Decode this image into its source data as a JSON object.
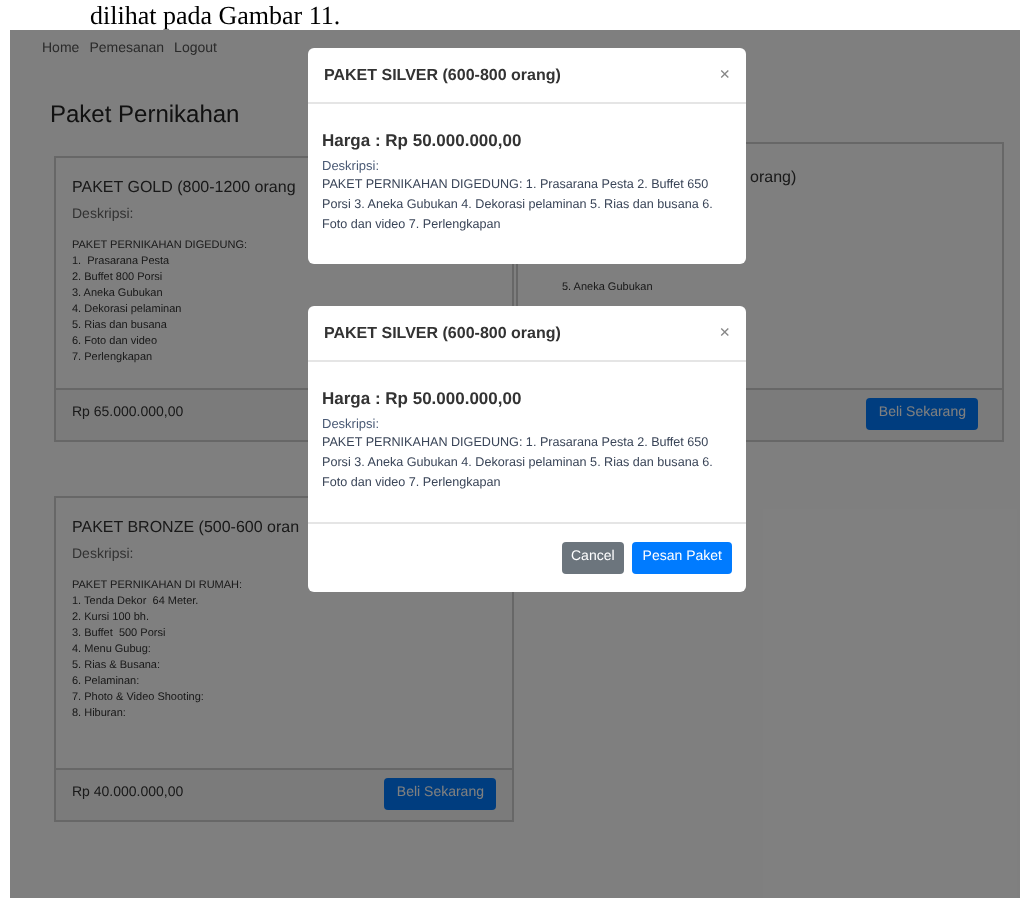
{
  "caption": "dilihat pada Gambar 11.",
  "nav": [
    {
      "label": "Home"
    },
    {
      "label": "Pemesanan"
    },
    {
      "label": "Logout"
    }
  ],
  "page_title": "Paket Pernikahan",
  "cards": [
    {
      "title": "PAKET GOLD (800-1200 orang",
      "desc_label": "Deskripsi:",
      "heading": "PAKET PERNIKAHAN DIGEDUNG:",
      "items": [
        "1.  Prasarana Pesta",
        "2. Buffet 800 Porsi",
        "3. Aneka Gubukan",
        "4. Dekorasi pelaminan",
        "5. Rias dan busana",
        "6. Foto dan video",
        "7. Perlengkapan"
      ],
      "price": "Rp 65.000.000,00"
    },
    {
      "title": "orang)",
      "items": [
        "5. Aneka Gubukan"
      ],
      "button": "Beli Sekarang"
    },
    {
      "title": "PAKET BRONZE (500-600 oran",
      "desc_label": "Deskripsi:",
      "heading": "PAKET PERNIKAHAN DI RUMAH:",
      "items": [
        "1. Tenda Dekor  64 Meter.",
        "2. Kursi 100 bh.",
        "3. Buffet  500 Porsi",
        "4. Menu Gubug:",
        "5. Rias & Busana:",
        "6. Pelaminan:",
        "7. Photo & Video Shooting:",
        "8. Hiburan:"
      ],
      "price": "Rp 40.000.000,00",
      "button": "Beli Sekarang"
    }
  ],
  "modals": [
    {
      "title": "PAKET SILVER (600-800 orang)",
      "close": "×",
      "price": "Harga : Rp 50.000.000,00",
      "desc_label": "Deskripsi:",
      "description": "PAKET PERNIKAHAN DIGEDUNG: 1. Prasarana Pesta 2. Buffet 650 Porsi 3. Aneka Gubukan 4. Dekorasi pelaminan 5. Rias dan busana 6. Foto dan video 7. Perlengkapan"
    },
    {
      "title": "PAKET SILVER (600-800 orang)",
      "close": "×",
      "price": "Harga : Rp 50.000.000,00",
      "desc_label": "Deskripsi:",
      "description": "PAKET PERNIKAHAN DIGEDUNG: 1. Prasarana Pesta 2. Buffet 650 Porsi 3. Aneka Gubukan 4. Dekorasi pelaminan 5. Rias dan busana 6. Foto dan video 7. Perlengkapan",
      "buttons": [
        {
          "label": "Cancel",
          "kind": "secondary"
        },
        {
          "label": "Pesan Paket",
          "kind": "primary"
        }
      ]
    }
  ]
}
